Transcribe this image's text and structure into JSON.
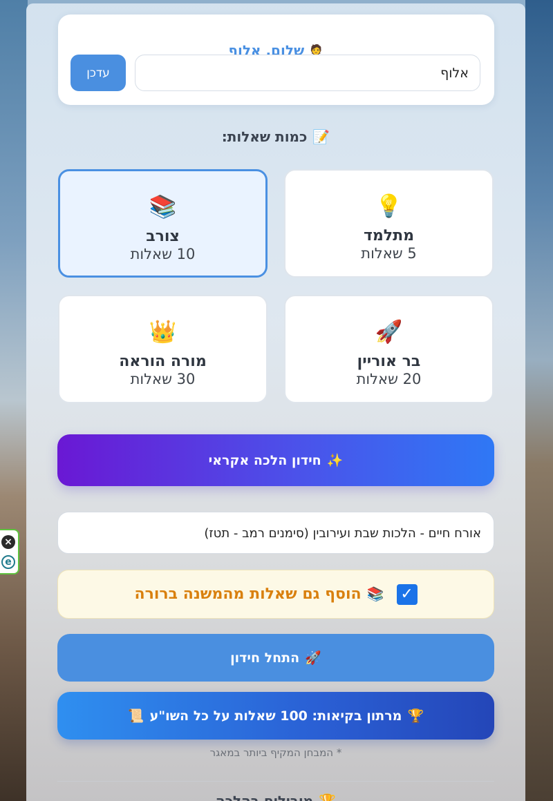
{
  "greeting": {
    "icon": "person-icon",
    "text": "שלום, אלוף",
    "name_value": "אלוף",
    "update_label": "עדכן"
  },
  "question_count": {
    "title": "כמות שאלות:",
    "icon": "memo-icon",
    "options": [
      {
        "emoji": "💡",
        "icon": "lightbulb-icon",
        "name": "מתלמד",
        "count": "5 שאלות",
        "selected": false
      },
      {
        "emoji": "📚",
        "icon": "books-icon",
        "name": "צורב",
        "count": "10 שאלות",
        "selected": true
      },
      {
        "emoji": "🚀",
        "icon": "rocket-icon",
        "name": "בר אוריין",
        "count": "20 שאלות",
        "selected": false
      },
      {
        "emoji": "👑",
        "icon": "crown-icon",
        "name": "מורה הוראה",
        "count": "30 שאלות",
        "selected": false
      }
    ]
  },
  "random_quiz": {
    "icon": "sparkles-icon",
    "emoji": "✨",
    "label": "חידון הלכה אקראי"
  },
  "section_select": {
    "value": "אורח חיים - הלכות שבת ועירובין (סימנים רמב - תטז)"
  },
  "mishna_berura": {
    "checked": true,
    "icon": "books-icon",
    "emoji": "📚",
    "label": "הוסף גם שאלות מהמשנה ברורה"
  },
  "start": {
    "icon": "rocket-icon",
    "emoji": "🚀",
    "label": "התחל חידון"
  },
  "marathon": {
    "icon_left": "trophy-icon",
    "emoji_left": "🏆",
    "label": "מרתון בקיאות: 100 שאלות על כל השו\"ע",
    "icon_right": "scroll-icon",
    "emoji_right": "📜"
  },
  "note": "* המבחן המקיף ביותר במאגר",
  "bottom_title": {
    "icon": "trophy-icon",
    "emoji": "🏆",
    "label": "מובילים בהלכה"
  },
  "colors": {
    "accent": "#4a90e2",
    "highlight": "#d9800e"
  }
}
